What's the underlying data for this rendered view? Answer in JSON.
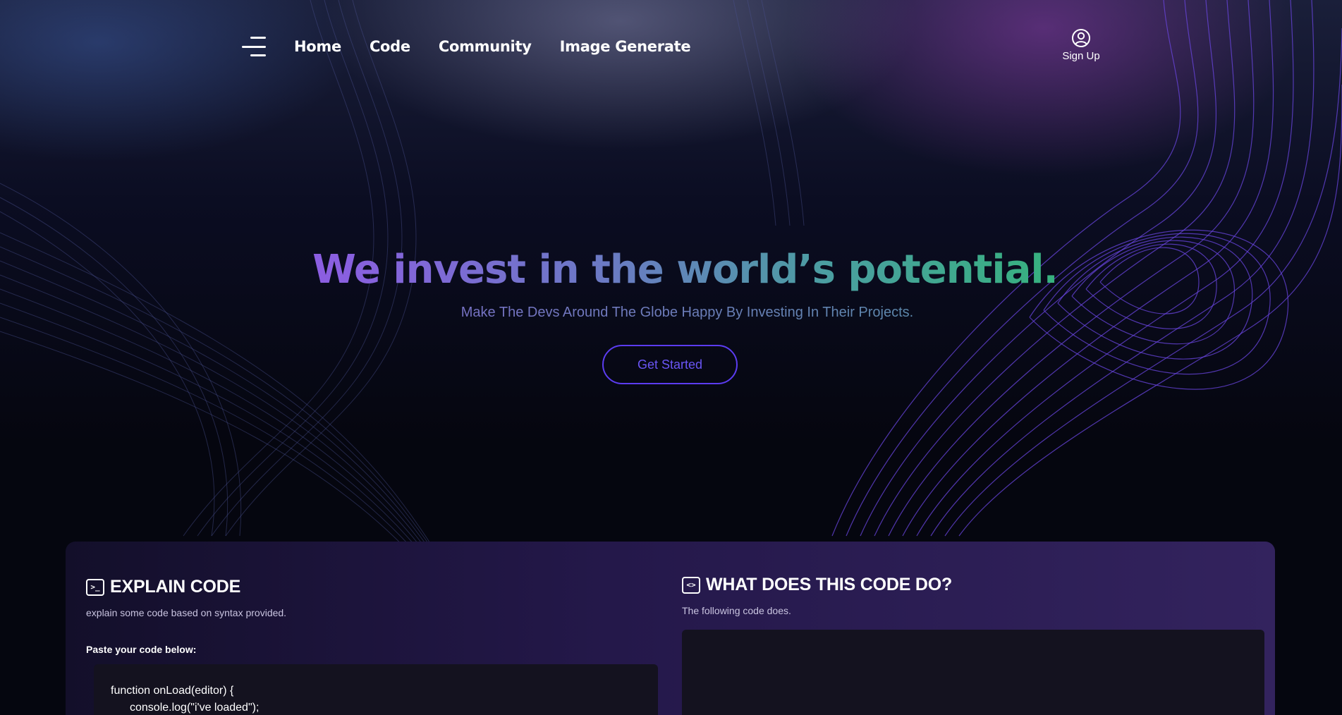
{
  "header": {
    "nav": [
      "Home",
      "Code",
      "Community",
      "Image Generate"
    ],
    "signup_label": "Sign Up"
  },
  "hero": {
    "title": "We invest in the world’s potential.",
    "subtitle": "Make The Devs Around The Globe Happy By Investing In Their Projects.",
    "cta_label": "Get Started"
  },
  "explain": {
    "title": "EXPLAIN CODE",
    "description": "explain some code based on syntax provided.",
    "paste_label": "Paste your code below:",
    "code_lines": [
      "function onLoad(editor) {",
      "console.log(\"i've loaded\");"
    ]
  },
  "what": {
    "title": "WHAT DOES THIS CODE DO?",
    "description": "The following code does."
  },
  "colors": {
    "accent": "#5b3cf0",
    "title_start": "#a152f0",
    "title_end": "#28c165",
    "panel": "#24184a"
  }
}
